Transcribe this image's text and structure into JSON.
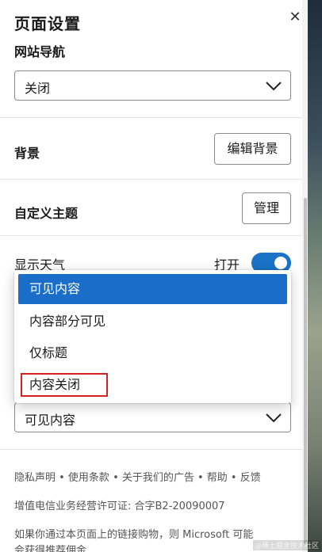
{
  "panel": {
    "title": "页面设置",
    "close_glyph": "✕"
  },
  "nav": {
    "label": "网站导航",
    "value": "关闭"
  },
  "background": {
    "label": "背景",
    "button": "编辑背景"
  },
  "theme": {
    "label": "自定义主题",
    "button": "管理"
  },
  "weather": {
    "label": "显示天气",
    "state": "打开",
    "enabled": true
  },
  "content_dropdown": {
    "options": [
      "可见内容",
      "内容部分可见",
      "仅标题",
      "内容关闭"
    ],
    "highlighted": "可见内容",
    "annotated": "内容关闭",
    "value": "可见内容"
  },
  "footer": {
    "links": "隐私声明 • 使用条款 • 关于我们的广告 • 帮助 • 反馈",
    "license": "增值电信业务经营许可证: 合字B2-20090007",
    "note_line1": "如果你通过本页面上的链接购物，则 Microsoft 可能",
    "note_line2": "会获得推荐佣金"
  },
  "watermark": "@稀土掘金技术社区",
  "colors": {
    "accent": "#1a6dc8",
    "annotation": "#d42222"
  },
  "icons": {
    "close": "close-icon",
    "chevron": "chevron-down-icon"
  }
}
